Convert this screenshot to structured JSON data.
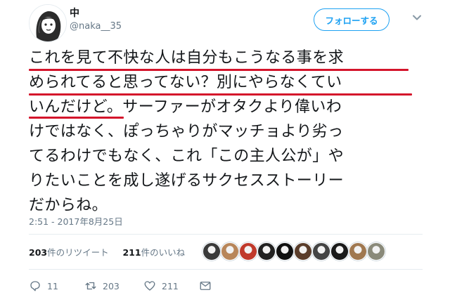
{
  "user": {
    "display_name": "中",
    "handle": "@naka__35",
    "avatar_icon": "user-avatar-icon"
  },
  "header": {
    "follow_label": "フォローする",
    "menu_icon": "chevron-down-icon"
  },
  "tweet": {
    "lines": [
      "これを見て不快な人は自分もこうなる事を求",
      "められてると思ってない？別にやらなくてい",
      "いんだけど。サーファーがオタクより偉いわ",
      "けではなく、ぽっちゃりがマッチョより劣っ",
      "てるわけでもなく、これ「この主人公が」や",
      "りたいことを成し遂げるサクセスストーリー",
      "だからね。"
    ],
    "highlight_color": "#d4142b",
    "timestamp": "2:51 - 2017年8月25日"
  },
  "stats": {
    "retweet_count": "203",
    "retweet_label": "件のリツイート",
    "like_count": "211",
    "like_label": "件のいいね"
  },
  "liked_by_avatars": [
    {
      "name": "liker-avatar-1",
      "color": "#3a3a3a"
    },
    {
      "name": "liker-avatar-2",
      "color": "#b8865a"
    },
    {
      "name": "liker-avatar-3",
      "color": "#c0392b"
    },
    {
      "name": "liker-avatar-4",
      "color": "#222222"
    },
    {
      "name": "liker-avatar-5",
      "color": "#111111"
    },
    {
      "name": "liker-avatar-6",
      "color": "#5a3d2b"
    },
    {
      "name": "liker-avatar-7",
      "color": "#444444"
    },
    {
      "name": "liker-avatar-8",
      "color": "#1a1a1a"
    },
    {
      "name": "liker-avatar-9",
      "color": "#a07850"
    },
    {
      "name": "liker-avatar-10",
      "color": "#8a8a7a"
    }
  ],
  "actions": {
    "reply_count": "11",
    "retweet_count": "203",
    "like_count": "211"
  },
  "colors": {
    "accent": "#1da1f2",
    "muted": "#657786"
  }
}
